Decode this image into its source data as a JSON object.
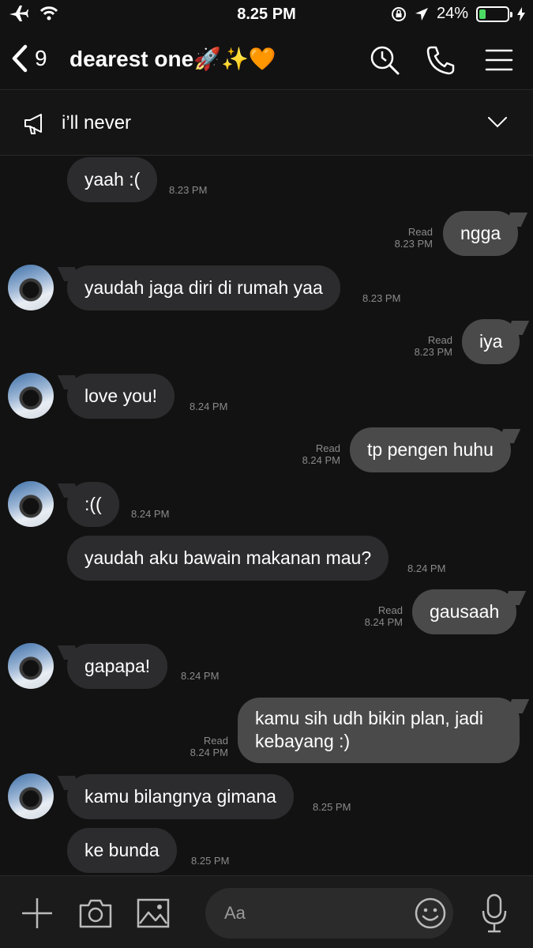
{
  "status_bar": {
    "time": "8.25 PM",
    "battery": "24%",
    "battery_level": 0.24
  },
  "header": {
    "back_count": "9",
    "title": "dearest one🚀✨🧡",
    "icons": [
      "back-chevron-icon",
      "search-clock-icon",
      "phone-icon",
      "menu-icon"
    ]
  },
  "announcement": {
    "text": "i’ll never",
    "icon": "megaphone-icon"
  },
  "messages": [
    {
      "side": "in",
      "text": "yaah :(",
      "time": "8.23 PM"
    },
    {
      "side": "out",
      "text": "ngga",
      "read": "Read",
      "time": "8.23 PM"
    },
    {
      "side": "in",
      "text": "yaudah jaga diri di rumah yaa",
      "time": "8.23 PM"
    },
    {
      "side": "out",
      "text": "iya",
      "read": "Read",
      "time": "8.23 PM"
    },
    {
      "side": "in",
      "text": "love you!",
      "time": "8.24 PM"
    },
    {
      "side": "out",
      "text": "tp pengen huhu",
      "read": "Read",
      "time": "8.24 PM"
    },
    {
      "side": "in",
      "text": ":((",
      "time": "8.24 PM"
    },
    {
      "side": "in",
      "text": "yaudah aku bawain makanan mau?",
      "time": "8.24 PM"
    },
    {
      "side": "out",
      "text": "gausaah",
      "read": "Read",
      "time": "8.24 PM"
    },
    {
      "side": "in",
      "text": "gapapa!",
      "time": "8.24 PM"
    },
    {
      "side": "out",
      "line1": "kamu sih udh bikin plan, jadi",
      "line2": "kebayang :)",
      "read": "Read",
      "time": "8.24 PM"
    },
    {
      "side": "in",
      "text": "kamu bilangnya gimana",
      "time": "8.25 PM"
    },
    {
      "side": "in",
      "text": "ke bunda",
      "time": "8.25 PM"
    }
  ],
  "composer": {
    "placeholder": "Aa",
    "icons": [
      "plus-icon",
      "camera-icon",
      "image-icon",
      "emoji-icon",
      "microphone-icon"
    ]
  }
}
